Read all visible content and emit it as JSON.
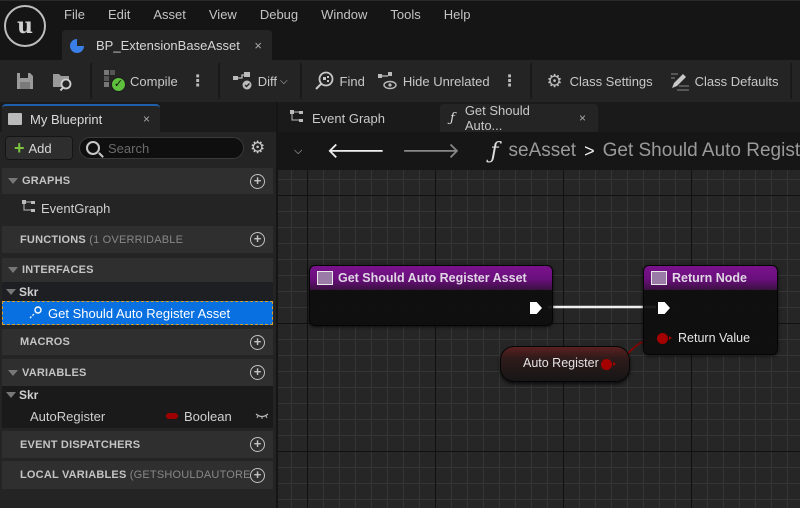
{
  "app": {
    "logo": "unreal-engine-logo",
    "menu": [
      "File",
      "Edit",
      "Asset",
      "View",
      "Debug",
      "Window",
      "Tools",
      "Help"
    ],
    "document_tab": {
      "label": "BP_ExtensionBaseAsset",
      "close": "×"
    }
  },
  "toolbar": {
    "save_icon": "save-icon",
    "browse_icon": "browse-icon",
    "compile_label": "Compile",
    "diff_label": "Diff",
    "find_label": "Find",
    "hide_unrelated_label": "Hide Unrelated",
    "class_settings_label": "Class Settings",
    "class_defaults_label": "Class Defaults",
    "kebab": "⋮"
  },
  "my_blueprint": {
    "tab_label": "My Blueprint",
    "close": "×",
    "add_label": "Add",
    "search_placeholder": "Search",
    "sections": {
      "graphs": "GRAPHS",
      "functions": "FUNCTIONS",
      "functions_sub": "(1 OVERRIDABLE",
      "interfaces": "INTERFACES",
      "macros": "MACROS",
      "variables": "VARIABLES",
      "event_dispatchers": "EVENT DISPATCHERS",
      "local_variables": "LOCAL VARIABLES",
      "local_variables_sub": "(GETSHOULDAUTOREGIST"
    },
    "graphs_items": [
      "EventGraph"
    ],
    "interface_category": "Skr",
    "interface_items": [
      "Get Should Auto Register Asset"
    ],
    "variable_category": "Skr",
    "variables": [
      {
        "name": "AutoRegister",
        "type": "Boolean",
        "type_color": "#a10000"
      }
    ]
  },
  "graph": {
    "tabs": [
      {
        "label": "Event Graph",
        "icon": "event-graph-icon"
      },
      {
        "label": "Get Should Auto...",
        "icon": "function-icon",
        "close": "×"
      }
    ],
    "breadcrumb": {
      "parent": "seAsset",
      "separator": ">",
      "current": "Get Should Auto Register Asset"
    },
    "nodes": {
      "entry": {
        "title": "Get Should Auto Register Asset",
        "header_color": "#7a128d"
      },
      "return": {
        "title": "Return Node",
        "pin_label": "Return Value",
        "header_color": "#7a128d"
      },
      "variable": {
        "label": "Auto Register",
        "pin_color": "#a50000"
      }
    }
  }
}
